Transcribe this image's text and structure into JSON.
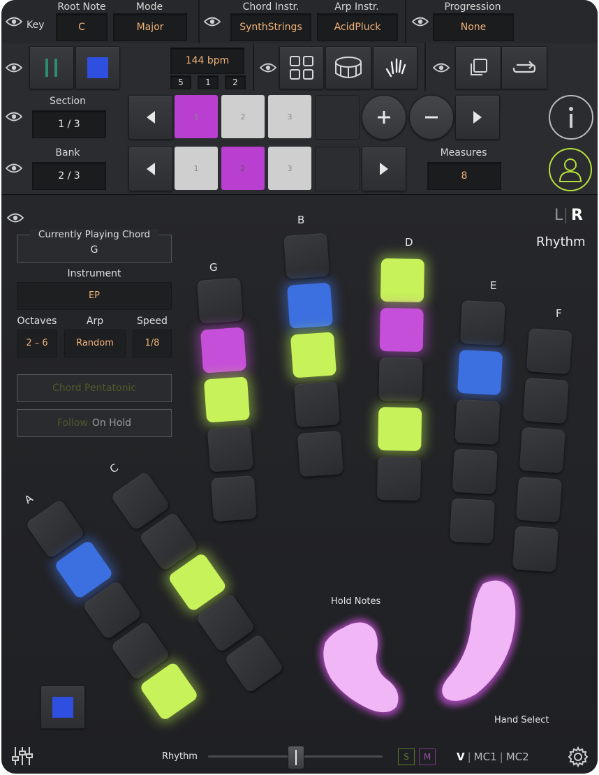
{
  "top": {
    "key_label": "Key",
    "root_note_label": "Root Note",
    "root_note_value": "C",
    "mode_label": "Mode",
    "mode_value": "Major",
    "chord_instr_label": "Chord Instr.",
    "chord_instr_value": "SynthStrings",
    "arp_instr_label": "Arp Instr.",
    "arp_instr_value": "AcidPluck",
    "progression_label": "Progression",
    "progression_value": "None"
  },
  "transport": {
    "bpm": "144 bpm",
    "position": [
      "5",
      "1",
      "2"
    ]
  },
  "section": {
    "label": "Section",
    "value": "1 / 3",
    "slots": [
      "1",
      "2",
      "3"
    ],
    "active_index": 0
  },
  "bank": {
    "label": "Bank",
    "value": "2 / 3",
    "slots": [
      "1",
      "2",
      "3"
    ],
    "active_index": 1,
    "measures_label": "Measures",
    "measures_value": "8"
  },
  "side": {
    "lr_left": "L",
    "lr_right": "R",
    "mode_label": "Rhythm"
  },
  "panel": {
    "current_chord_label": "Currently Playing Chord",
    "current_chord_value": "G",
    "instrument_label": "Instrument",
    "instrument_value": "EP",
    "octaves_label": "Octaves",
    "octaves_value": "2 – 6",
    "arp_label": "Arp",
    "arp_value": "Random",
    "speed_label": "Speed",
    "speed_value": "1/8",
    "chord_pentatonic": "Chord Pentatonic",
    "follow_label": "Follow",
    "on_hold_label": "On Hold"
  },
  "fingers": [
    {
      "label": "A",
      "cells": [
        "off",
        "blue",
        "off",
        "off",
        "green"
      ]
    },
    {
      "label": "C",
      "cells": [
        "off",
        "off",
        "green",
        "off",
        "off"
      ]
    },
    {
      "label": "G",
      "cells": [
        "off",
        "magenta",
        "green",
        "off",
        "off"
      ]
    },
    {
      "label": "B",
      "cells": [
        "off",
        "blue",
        "green",
        "off",
        "off"
      ]
    },
    {
      "label": "D",
      "cells": [
        "green",
        "magenta",
        "off",
        "green",
        "off"
      ]
    },
    {
      "label": "E",
      "cells": [
        "off",
        "blue",
        "off",
        "off",
        "off"
      ]
    },
    {
      "label": "F",
      "cells": [
        "off",
        "off",
        "off",
        "off",
        "off"
      ]
    }
  ],
  "hold_notes_label": "Hold Notes",
  "hand_select_label": "Hand Select",
  "bottom": {
    "rhythm_label": "Rhythm",
    "slider_value": 0.5,
    "s_label": "S",
    "m_label": "M",
    "v_label": "V",
    "mc1_label": "MC1",
    "mc2_label": "MC2"
  },
  "colors": {
    "accent_orange": "#f0b27a",
    "pad_magenta": "#c64fd9",
    "pad_green": "#c7f25a",
    "pad_blue": "#3c6fe0",
    "play_green": "#2e8c6e",
    "stop_blue": "#2f4fe0",
    "user_ring": "#b6e13a"
  }
}
